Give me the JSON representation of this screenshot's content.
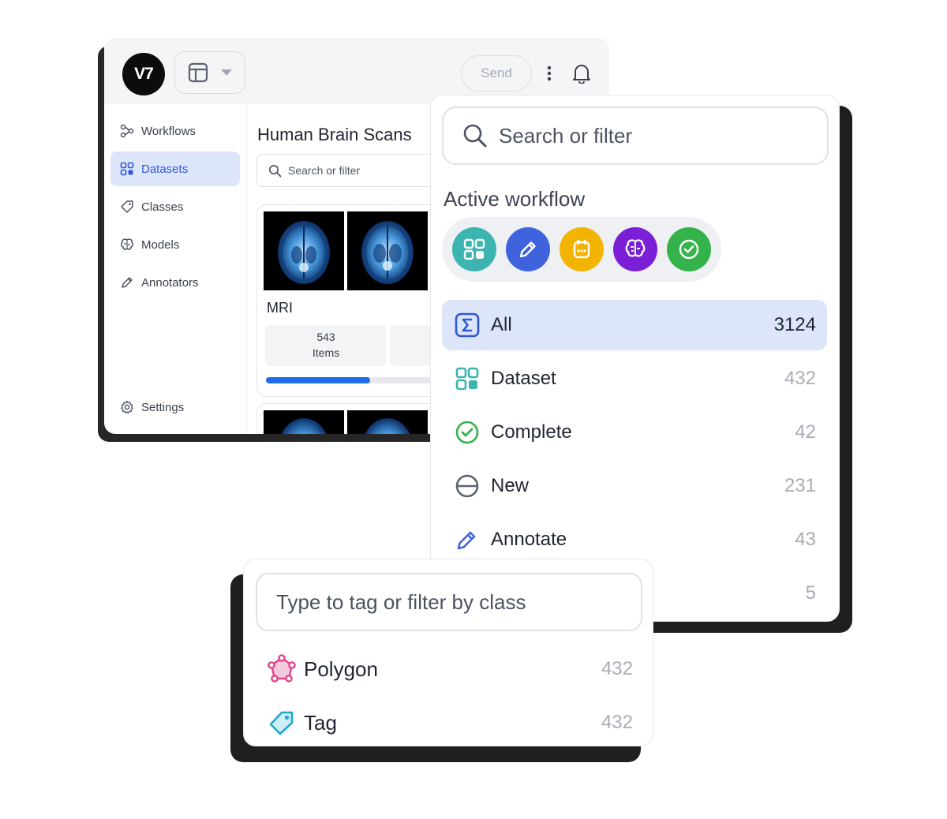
{
  "app": {
    "logo_text": "V7",
    "send_label": "Send",
    "sidebar": {
      "items": [
        {
          "label": "Workflows",
          "icon": "workflow-icon"
        },
        {
          "label": "Datasets",
          "icon": "grid-icon",
          "active": true
        },
        {
          "label": "Classes",
          "icon": "tag-icon"
        },
        {
          "label": "Models",
          "icon": "brain-icon"
        },
        {
          "label": "Annotators",
          "icon": "pencil-icon"
        }
      ],
      "settings_label": "Settings"
    },
    "main": {
      "title": "Human Brain Scans",
      "search_placeholder": "Search or filter",
      "card": {
        "label": "MRI",
        "items_count": "543",
        "items_label": "Items",
        "progress": 0.55
      }
    }
  },
  "filter_panel": {
    "search_placeholder": "Search or filter",
    "active_workflow_title": "Active workflow",
    "workflow_stages": [
      {
        "icon": "dataset-stage-icon",
        "color": "#3cb5b0"
      },
      {
        "icon": "annotate-stage-icon",
        "color": "#3e63dd"
      },
      {
        "icon": "review-stage-icon",
        "color": "#f2b400"
      },
      {
        "icon": "model-stage-icon",
        "color": "#7a1fd6"
      },
      {
        "icon": "complete-stage-icon",
        "color": "#33b34a"
      }
    ],
    "rows": [
      {
        "label": "All",
        "count": "3124",
        "icon": "sigma-icon",
        "active": true
      },
      {
        "label": "Dataset",
        "count": "432",
        "icon": "dataset-icon"
      },
      {
        "label": "Complete",
        "count": "42",
        "icon": "check-circle-icon"
      },
      {
        "label": "New",
        "count": "231",
        "icon": "new-circle-icon"
      },
      {
        "label": "Annotate",
        "count": "43",
        "icon": "pencil-icon"
      },
      {
        "label": "",
        "count": "5",
        "icon": ""
      }
    ]
  },
  "class_popup": {
    "placeholder": "Type to tag or filter by class",
    "rows": [
      {
        "label": "Polygon",
        "count": "432",
        "icon": "polygon-icon",
        "color": "#e0438c"
      },
      {
        "label": "Tag",
        "count": "432",
        "icon": "tag-icon",
        "color": "#22a7c9"
      }
    ]
  },
  "colors": {
    "accent": "#2f58d6",
    "active_bg": "#dde5fb",
    "progress": "#1e6be6"
  }
}
